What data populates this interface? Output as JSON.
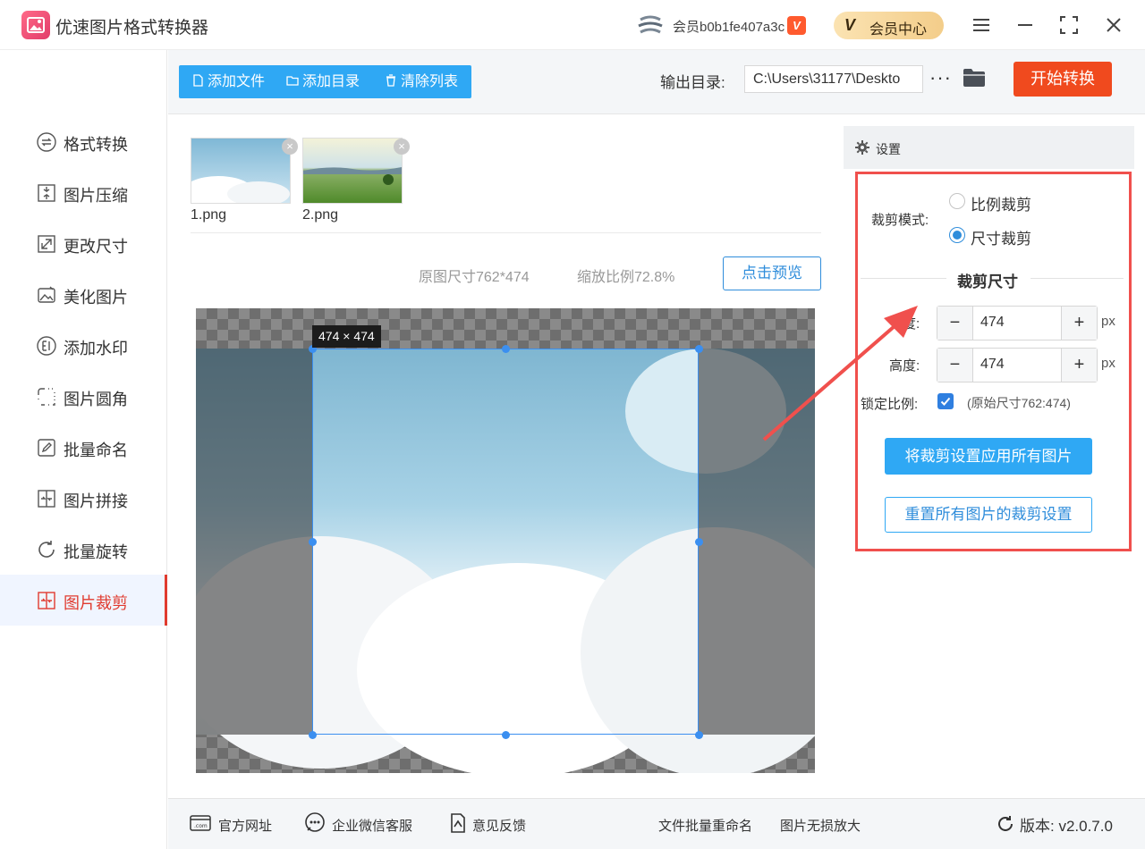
{
  "app": {
    "title": "优速图片格式转换器",
    "member_name": "会员b0b1fe407a3c",
    "member_badge": "V",
    "vip_mark": "V",
    "vip_label": "会员中心"
  },
  "sidebar": {
    "items": [
      {
        "label": "格式转换",
        "icon": "format-convert-icon"
      },
      {
        "label": "图片压缩",
        "icon": "compress-icon"
      },
      {
        "label": "更改尺寸",
        "icon": "resize-icon"
      },
      {
        "label": "美化图片",
        "icon": "beautify-icon"
      },
      {
        "label": "添加水印",
        "icon": "watermark-icon"
      },
      {
        "label": "图片圆角",
        "icon": "round-corner-icon"
      },
      {
        "label": "批量命名",
        "icon": "rename-icon"
      },
      {
        "label": "图片拼接",
        "icon": "stitch-icon"
      },
      {
        "label": "批量旋转",
        "icon": "rotate-icon"
      },
      {
        "label": "图片裁剪",
        "icon": "crop-icon",
        "active": true
      }
    ]
  },
  "toolbar": {
    "add_file": "添加文件",
    "add_dir": "添加目录",
    "clear_list": "清除列表",
    "output_label": "输出目录:",
    "output_path": "C:\\Users\\31177\\Deskto",
    "more": "···",
    "start": "开始转换"
  },
  "files": [
    {
      "name": "1.png"
    },
    {
      "name": "2.png"
    }
  ],
  "preview": {
    "original_size": "原图尺寸762*474",
    "zoom_ratio": "缩放比例72.8%",
    "preview_button": "点击预览",
    "crop_tag": "474 × 474"
  },
  "settings": {
    "title": "设置",
    "crop_mode_label": "裁剪模式:",
    "mode_ratio": "比例裁剪",
    "mode_size": "尺寸裁剪",
    "section_title": "裁剪尺寸",
    "width_label": "宽度:",
    "width_value": "474",
    "height_label": "高度:",
    "height_value": "474",
    "unit": "px",
    "lock_label": "锁定比例:",
    "lock_note": "(原始尺寸762:474)",
    "apply_all": "将裁剪设置应用所有图片",
    "reset_all": "重置所有图片的裁剪设置"
  },
  "footer": {
    "official_site": "官方网址",
    "wechat_service": "企业微信客服",
    "feedback": "意见反馈",
    "batch_rename": "文件批量重命名",
    "lossless_enlarge": "图片无损放大",
    "version": "版本: v2.0.7.0"
  },
  "colors": {
    "accent_blue": "#2fa8f4",
    "start_red": "#f04a1e",
    "active_red": "#e03b2f",
    "frame_red": "#f0504d"
  }
}
